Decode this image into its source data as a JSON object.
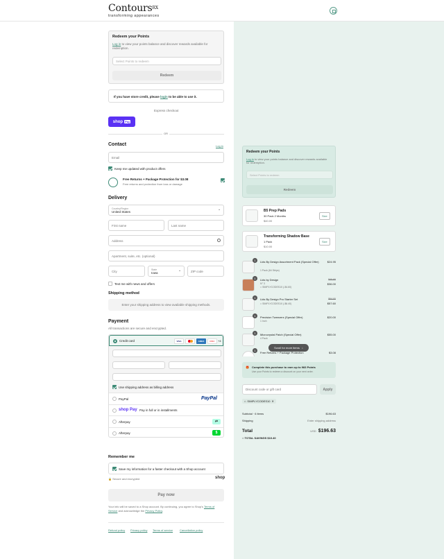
{
  "header": {
    "brand": "Contours",
    "brand_sup": "RX",
    "tagline": "transforming appearances"
  },
  "redeem": {
    "title": "Redeem your Points",
    "login_link": "Log in",
    "text": " to view your points balance and discover rewards available for redemption.",
    "placeholder": "Select Points to redeem",
    "button": "Redeem"
  },
  "store_credit": {
    "pre": "If you have store credit, please ",
    "link": "login",
    "post": " to be able to use it."
  },
  "express": {
    "label": "Express checkout",
    "shop_pay": "shop",
    "pay": "Pay",
    "or": "OR"
  },
  "contact": {
    "title": "Contact",
    "login": "Log in",
    "email_placeholder": "Email",
    "keep_updated": "Keep me updated with product offers"
  },
  "protection": {
    "title": "Free Returns + Package Protection for $3.08",
    "subtitle": "Free returns and protection from loss or damage"
  },
  "delivery": {
    "title": "Delivery",
    "country_label": "Country/Region",
    "country_value": "United States",
    "first_name": "First name",
    "last_name": "Last name",
    "address": "Address",
    "apartment": "Apartment, suite, etc. (optional)",
    "city": "City",
    "state_label": "State",
    "state_value": "Iowa",
    "zip": "ZIP code",
    "text_news": "Text me with news and offers"
  },
  "shipping": {
    "title": "Shipping method",
    "message": "Enter your shipping address to view available shipping methods."
  },
  "payment": {
    "title": "Payment",
    "subtitle": "All transactions are secure and encrypted.",
    "credit_card": "Credit card",
    "more_cards": "+4",
    "billing_same": "Use shipping address as billing address",
    "options": [
      {
        "label": "PayPal",
        "logo": "PayPal"
      },
      {
        "label": "Pay in full or in installments",
        "logo": "shop Pay"
      },
      {
        "label": "Afterpay",
        "logo": "afterpay-icon"
      },
      {
        "label": "Afterpay",
        "logo": "cashapp-icon"
      }
    ],
    "card_brands": [
      "VISA",
      "MC",
      "AMEX",
      "DISC"
    ]
  },
  "remember": {
    "title": "Remember me",
    "label": "Save my information for a faster checkout with a Shop account",
    "secure": "Secure and encrypted",
    "shop": "shop"
  },
  "pay_now": "Pay now",
  "legal": {
    "pre": "Your info will be saved to a Shop account. By continuing, you agree to Shop's ",
    "terms": "Terms of Service",
    "mid": " and acknowledge the ",
    "privacy": "Privacy Policy",
    "post": "."
  },
  "footer_links": [
    "Refund policy",
    "Privacy policy",
    "Terms of service",
    "Cancellation policy"
  ],
  "upsell": [
    {
      "name": "B5 Prep Pads",
      "variant": "30 Pack 2 Months",
      "price": "$40.00",
      "button": "Size"
    },
    {
      "name": "Transforming Shadow Base",
      "variant": "1 Pack",
      "price": "$10.00",
      "button": "Size"
    }
  ],
  "items": [
    {
      "qty": "1",
      "name": "Lids By Design Assortment Pack (Special Offer)",
      "variant": "1 Pack (64 Strips)",
      "discount": "",
      "old_price": "",
      "price": "$24.95"
    },
    {
      "qty": "1",
      "name": "Lids by Design",
      "variant": "N° 3",
      "discount": "SIMPLYCODES10 (-$4.60)",
      "old_price": "$40.60",
      "price": "$36.00"
    },
    {
      "qty": "1",
      "name": "Lids By Design Pro Starter Set",
      "variant": "",
      "discount": "SIMPLYCODES10 (-$6.40)",
      "old_price": "$64.00",
      "price": "$57.60"
    },
    {
      "qty": "1",
      "name": "Precision Tweezers (Special Offer)",
      "variant": "1 Inch",
      "discount": "",
      "old_price": "",
      "price": "$20.00"
    },
    {
      "qty": "1",
      "name": "Microcrystal Patch (Special Offer)",
      "variant": "4 Pack",
      "discount": "",
      "old_price": "",
      "price": "$55.00"
    },
    {
      "qty": "1",
      "name": "Free Returns + Package Protection",
      "variant": "",
      "discount": "",
      "old_price": "",
      "price": "$3.08"
    }
  ],
  "scroll_hint": "Scroll for more items",
  "points_banner": {
    "title": "Complete this purchase to earn up to 983 Points",
    "text": "Use your Points to redeem a discount on your next order."
  },
  "discount": {
    "placeholder": "Discount code or gift card",
    "button": "Apply",
    "applied_code": "SIMPLYCODES10"
  },
  "totals": {
    "subtotal_label": "Subtotal · 6 items",
    "subtotal": "$196.63",
    "shipping_label": "Shipping",
    "shipping": "Enter shipping address",
    "total_label": "Total",
    "currency": "USD",
    "total": "$196.63",
    "savings_label": "TOTAL SAVINGS",
    "savings": "$10.40"
  }
}
